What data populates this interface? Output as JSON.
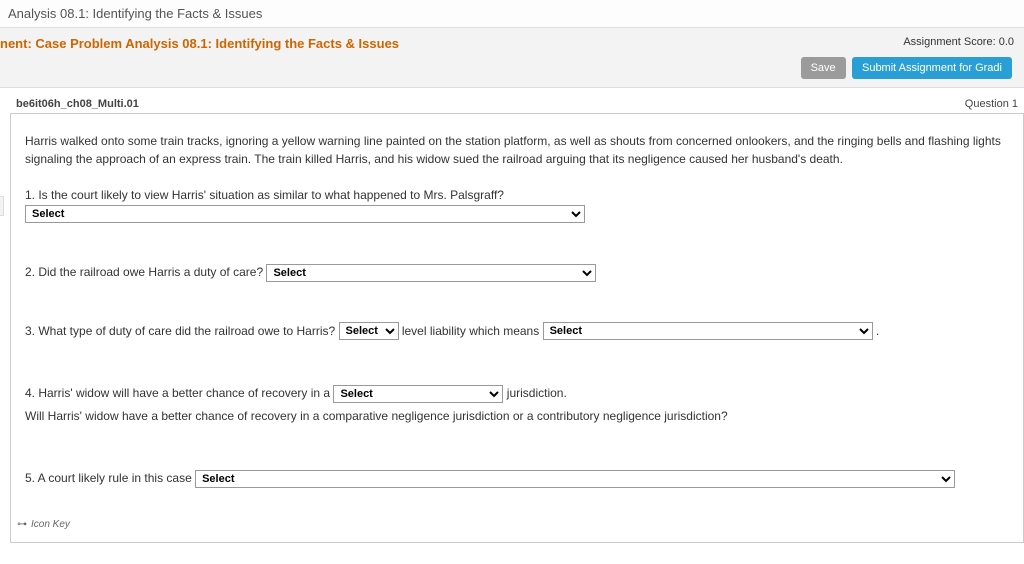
{
  "page_title": "Analysis 08.1: Identifying the Facts & Issues",
  "assignment": {
    "title": "nent: Case Problem Analysis 08.1: Identifying the Facts & Issues",
    "score_label": "Assignment Score: 0.0",
    "save_label": "Save",
    "submit_label": "Submit Assignment for Gradi"
  },
  "question": {
    "id": "be6it06h_ch08_Multi.01",
    "number_label": "Question 1",
    "scenario": "Harris walked onto some train tracks, ignoring a yellow warning line painted on the station platform, as well as shouts from concerned onlookers, and the ringing bells and flashing lights signaling the approach of an express train. The train killed Harris, and his widow sued the railroad arguing that its negligence caused her husband's death.",
    "items": [
      {
        "prefix": "1. Is the court likely to view Harris' situation as similar to what happened to Mrs. Palsgraff?",
        "select1_placeholder": "Select"
      },
      {
        "prefix": "2. Did the railroad owe Harris a duty of care?",
        "select1_placeholder": "Select"
      },
      {
        "prefix": "3. What type of duty of care did the railroad owe to Harris?",
        "select1_placeholder": "Select",
        "mid": "level liability which means",
        "select2_placeholder": "Select",
        "suffix": "."
      },
      {
        "prefix": "4. Harris' widow will have a better chance of recovery in a",
        "select1_placeholder": "Select",
        "suffix": "jurisdiction.",
        "sub": "Will Harris' widow have a better chance of recovery in a comparative negligence jurisdiction or a contributory negligence jurisdiction?"
      },
      {
        "prefix": "5. A court likely rule in this case",
        "select1_placeholder": "Select"
      }
    ]
  },
  "icon_key": {
    "glyph": "⊶",
    "label": "Icon Key"
  }
}
